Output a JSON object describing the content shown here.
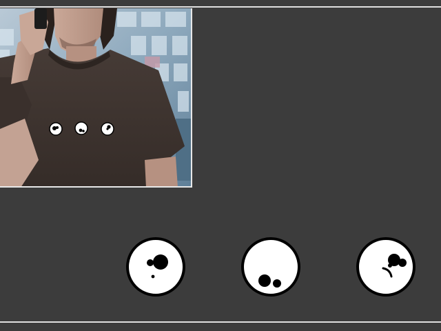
{
  "page": {
    "background_color": "#3c3c3c",
    "rule_color": "#e0e0e0"
  },
  "photo": {
    "description_icon": "man-in-tshirt-photo",
    "shirt_color": "#3d3430",
    "badge_count_on_shirt": 3
  },
  "badges": [
    {
      "name": "badge-design-1",
      "icon": "dots-cluster-center"
    },
    {
      "name": "badge-design-2",
      "icon": "dots-cluster-bottom"
    },
    {
      "name": "badge-design-3",
      "icon": "dots-cluster-smile"
    }
  ],
  "colors": {
    "badge_fill": "#ffffff",
    "badge_ring": "#000000",
    "badge_dots": "#000000"
  }
}
